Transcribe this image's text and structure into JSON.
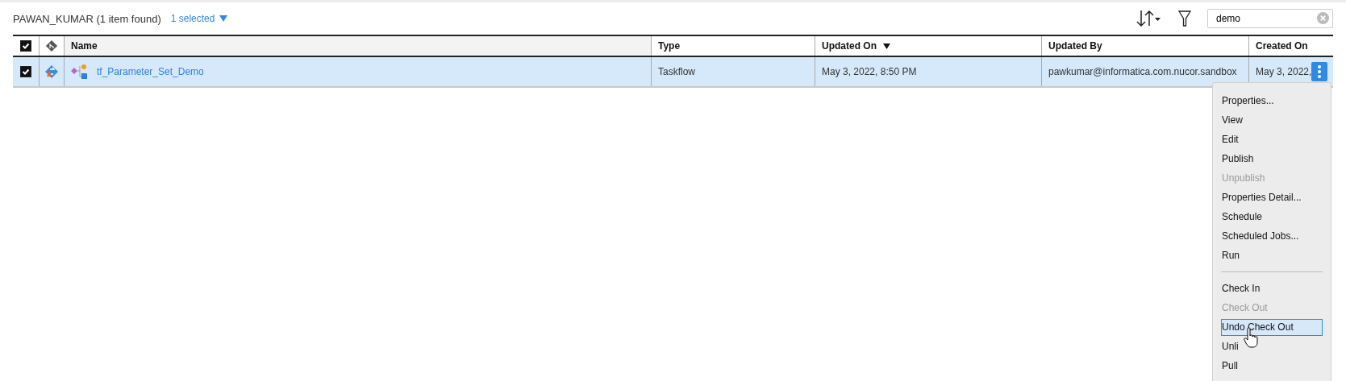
{
  "header": {
    "title": "PAWAN_KUMAR (1 item found)",
    "selection": "1 selected"
  },
  "search": {
    "value": "demo"
  },
  "table": {
    "select_all_checked": true,
    "columns": [
      {
        "label": "Name",
        "sorted": false
      },
      {
        "label": "Type",
        "sorted": false
      },
      {
        "label": "Updated On",
        "sorted": true
      },
      {
        "label": "Updated By",
        "sorted": false
      },
      {
        "label": "Created On",
        "sorted": false
      }
    ],
    "rows": [
      {
        "selected": true,
        "checked": true,
        "name": "tf_Parameter_Set_Demo",
        "type": "Taskflow",
        "updated_on": "May 3, 2022, 8:50 PM",
        "updated_by": "pawkumar@informatica.com.nucor.sandbox",
        "created_on": "May 3, 2022,"
      }
    ]
  },
  "context_menu": {
    "items": [
      {
        "kind": "item",
        "label": "Properties...",
        "disabled": false,
        "selected": false
      },
      {
        "kind": "item",
        "label": "View",
        "disabled": false,
        "selected": false
      },
      {
        "kind": "item",
        "label": "Edit",
        "disabled": false,
        "selected": false
      },
      {
        "kind": "item",
        "label": "Publish",
        "disabled": false,
        "selected": false
      },
      {
        "kind": "item",
        "label": "Unpublish",
        "disabled": true,
        "selected": false
      },
      {
        "kind": "item",
        "label": "Properties Detail...",
        "disabled": false,
        "selected": false
      },
      {
        "kind": "item",
        "label": "Schedule",
        "disabled": false,
        "selected": false
      },
      {
        "kind": "item",
        "label": "Scheduled Jobs...",
        "disabled": false,
        "selected": false
      },
      {
        "kind": "item",
        "label": "Run",
        "disabled": false,
        "selected": false
      },
      {
        "kind": "separator"
      },
      {
        "kind": "item",
        "label": "Check In",
        "disabled": false,
        "selected": false
      },
      {
        "kind": "item",
        "label": "Check Out",
        "disabled": true,
        "selected": false
      },
      {
        "kind": "item",
        "label": "Undo Check Out",
        "disabled": false,
        "selected": true
      },
      {
        "kind": "item",
        "label": "Unli",
        "disabled": false,
        "selected": false
      },
      {
        "kind": "item",
        "label": "Pull",
        "disabled": false,
        "selected": false
      }
    ]
  }
}
